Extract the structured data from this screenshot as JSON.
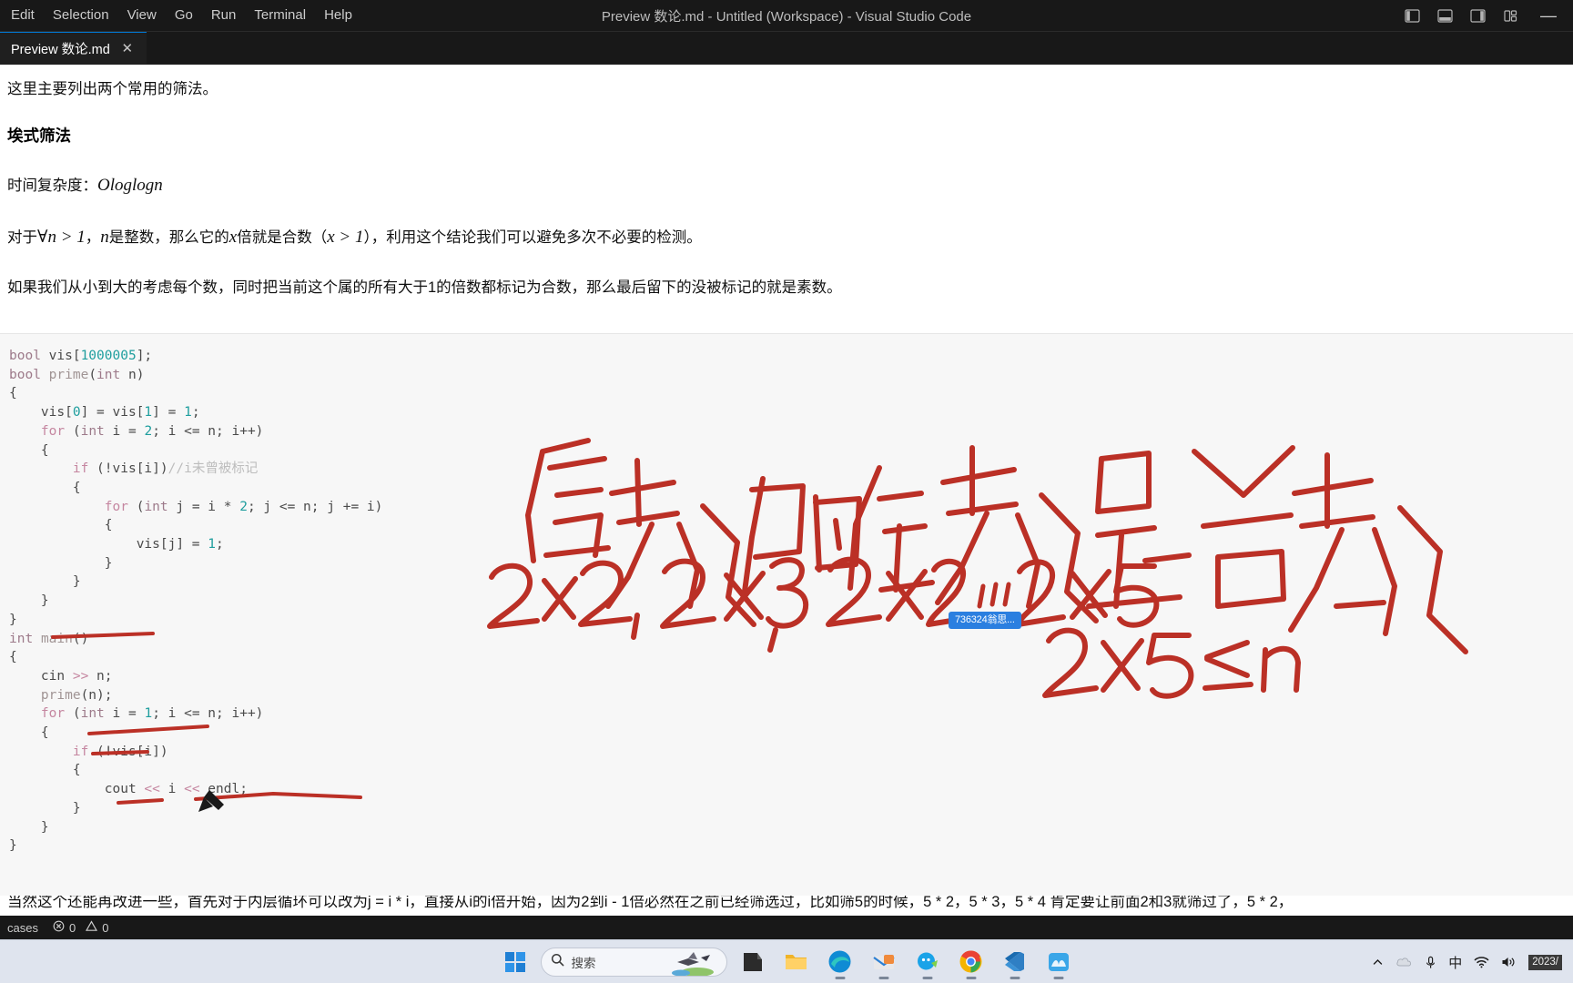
{
  "window": {
    "title": "Preview 数论.md - Untitled (Workspace) - Visual Studio Code",
    "menus": [
      "Edit",
      "Selection",
      "View",
      "Go",
      "Run",
      "Terminal",
      "Help"
    ],
    "controls": {
      "toggle_primary_sidebar": "toggle-primary-sidebar-icon",
      "toggle_panel": "toggle-panel-icon",
      "toggle_secondary_sidebar": "toggle-secondary-sidebar-icon",
      "customize_layout": "customize-layout-icon",
      "minimize": "—"
    }
  },
  "tabs": [
    {
      "label": "Preview 数论.md",
      "close": "✕",
      "active": true
    }
  ],
  "preview": {
    "intro": "这里主要列出两个常用的筛法。",
    "heading": "埃式筛法",
    "complexity_prefix": "时间复杂度：",
    "complexity_math": "Ologlogn",
    "para2": {
      "p1": "对于",
      "m1": "∀n > 1",
      "p2": "，",
      "m2": "n",
      "p3": "是整数，那么它的",
      "m3": "x",
      "p4": "倍就是合数（",
      "m4": "x > 1",
      "p5": "），利用这个结论我们可以避免多次不必要的检测。"
    },
    "para3": "如果我们从小到大的考虑每个数，同时把当前这个属的所有大于1的倍数都标记为合数，那么最后留下的没被标记的就是素数。",
    "bottom_clipped": "当然这个还能再改进一些，首先对于内层循环可以改为j = i * i，直接从i的i倍开始，因为2到i - 1倍必然在之前已经筛选过，比如筛5的时候，5 * 2，5 * 3，5 * 4 肯定要让前面2和3就筛过了，5 * 2，"
  },
  "code": {
    "language": "cpp",
    "lines": [
      "bool vis[1000005];",
      "bool prime(int n)",
      "{",
      "    vis[0] = vis[1] = 1;",
      "    for (int i = 2; i <= n; i++)",
      "    {",
      "        if (!vis[i])//i未曾被标记",
      "        {",
      "            for (int j = i * 2; j <= n; j += i)",
      "            {",
      "                vis[j] = 1;",
      "            }",
      "        }",
      "    }",
      "}",
      "int main()",
      "{",
      "    cin >> n;",
      "    prime(n);",
      "    for (int i = 1; i <= n; i++)",
      "    {",
      "        if (!vis[i])",
      "        {",
      "            cout << i << endl;",
      "        }",
      "    }",
      "}"
    ],
    "comment_text": "//i未曾被标记"
  },
  "annotations": {
    "ink_color": "#c0392b",
    "line1": "质数的倍数是合数",
    "line2": "2×2,  2×3, 2×4,...,2×5",
    "line3": "2×5 ≤ n",
    "cursor": "pen-cursor",
    "badge": "736324翁思..."
  },
  "statusbar": {
    "left_label": "cases",
    "errors_icon": "error-circle-icon",
    "errors": "0",
    "warnings_icon": "warning-triangle-icon",
    "warnings": "0"
  },
  "taskbar": {
    "start": "windows-start-icon",
    "search_placeholder": "搜索",
    "search_icon": "search-icon",
    "apps": [
      {
        "name": "taskbar-app-explorer-dark",
        "running": false
      },
      {
        "name": "taskbar-app-file-explorer",
        "running": false
      },
      {
        "name": "taskbar-app-edge",
        "running": true
      },
      {
        "name": "taskbar-app-mail",
        "running": true
      },
      {
        "name": "taskbar-app-qq",
        "running": true
      },
      {
        "name": "taskbar-app-chrome",
        "running": true
      },
      {
        "name": "taskbar-app-vscode",
        "running": true
      },
      {
        "name": "taskbar-app-xmind",
        "running": true
      }
    ],
    "tray": {
      "chevron": "chevron-up-icon",
      "cloud": "onedrive-icon",
      "mic": "microphone-icon",
      "ime": "中",
      "wifi": "wifi-icon",
      "volume": "volume-icon",
      "date": "2023/"
    }
  },
  "colors": {
    "accent": "#0078d4",
    "ink": "#c0392b",
    "badge": "#2b7fe0",
    "titlebar_bg": "#181818",
    "code_bg": "#f7f7f7"
  }
}
